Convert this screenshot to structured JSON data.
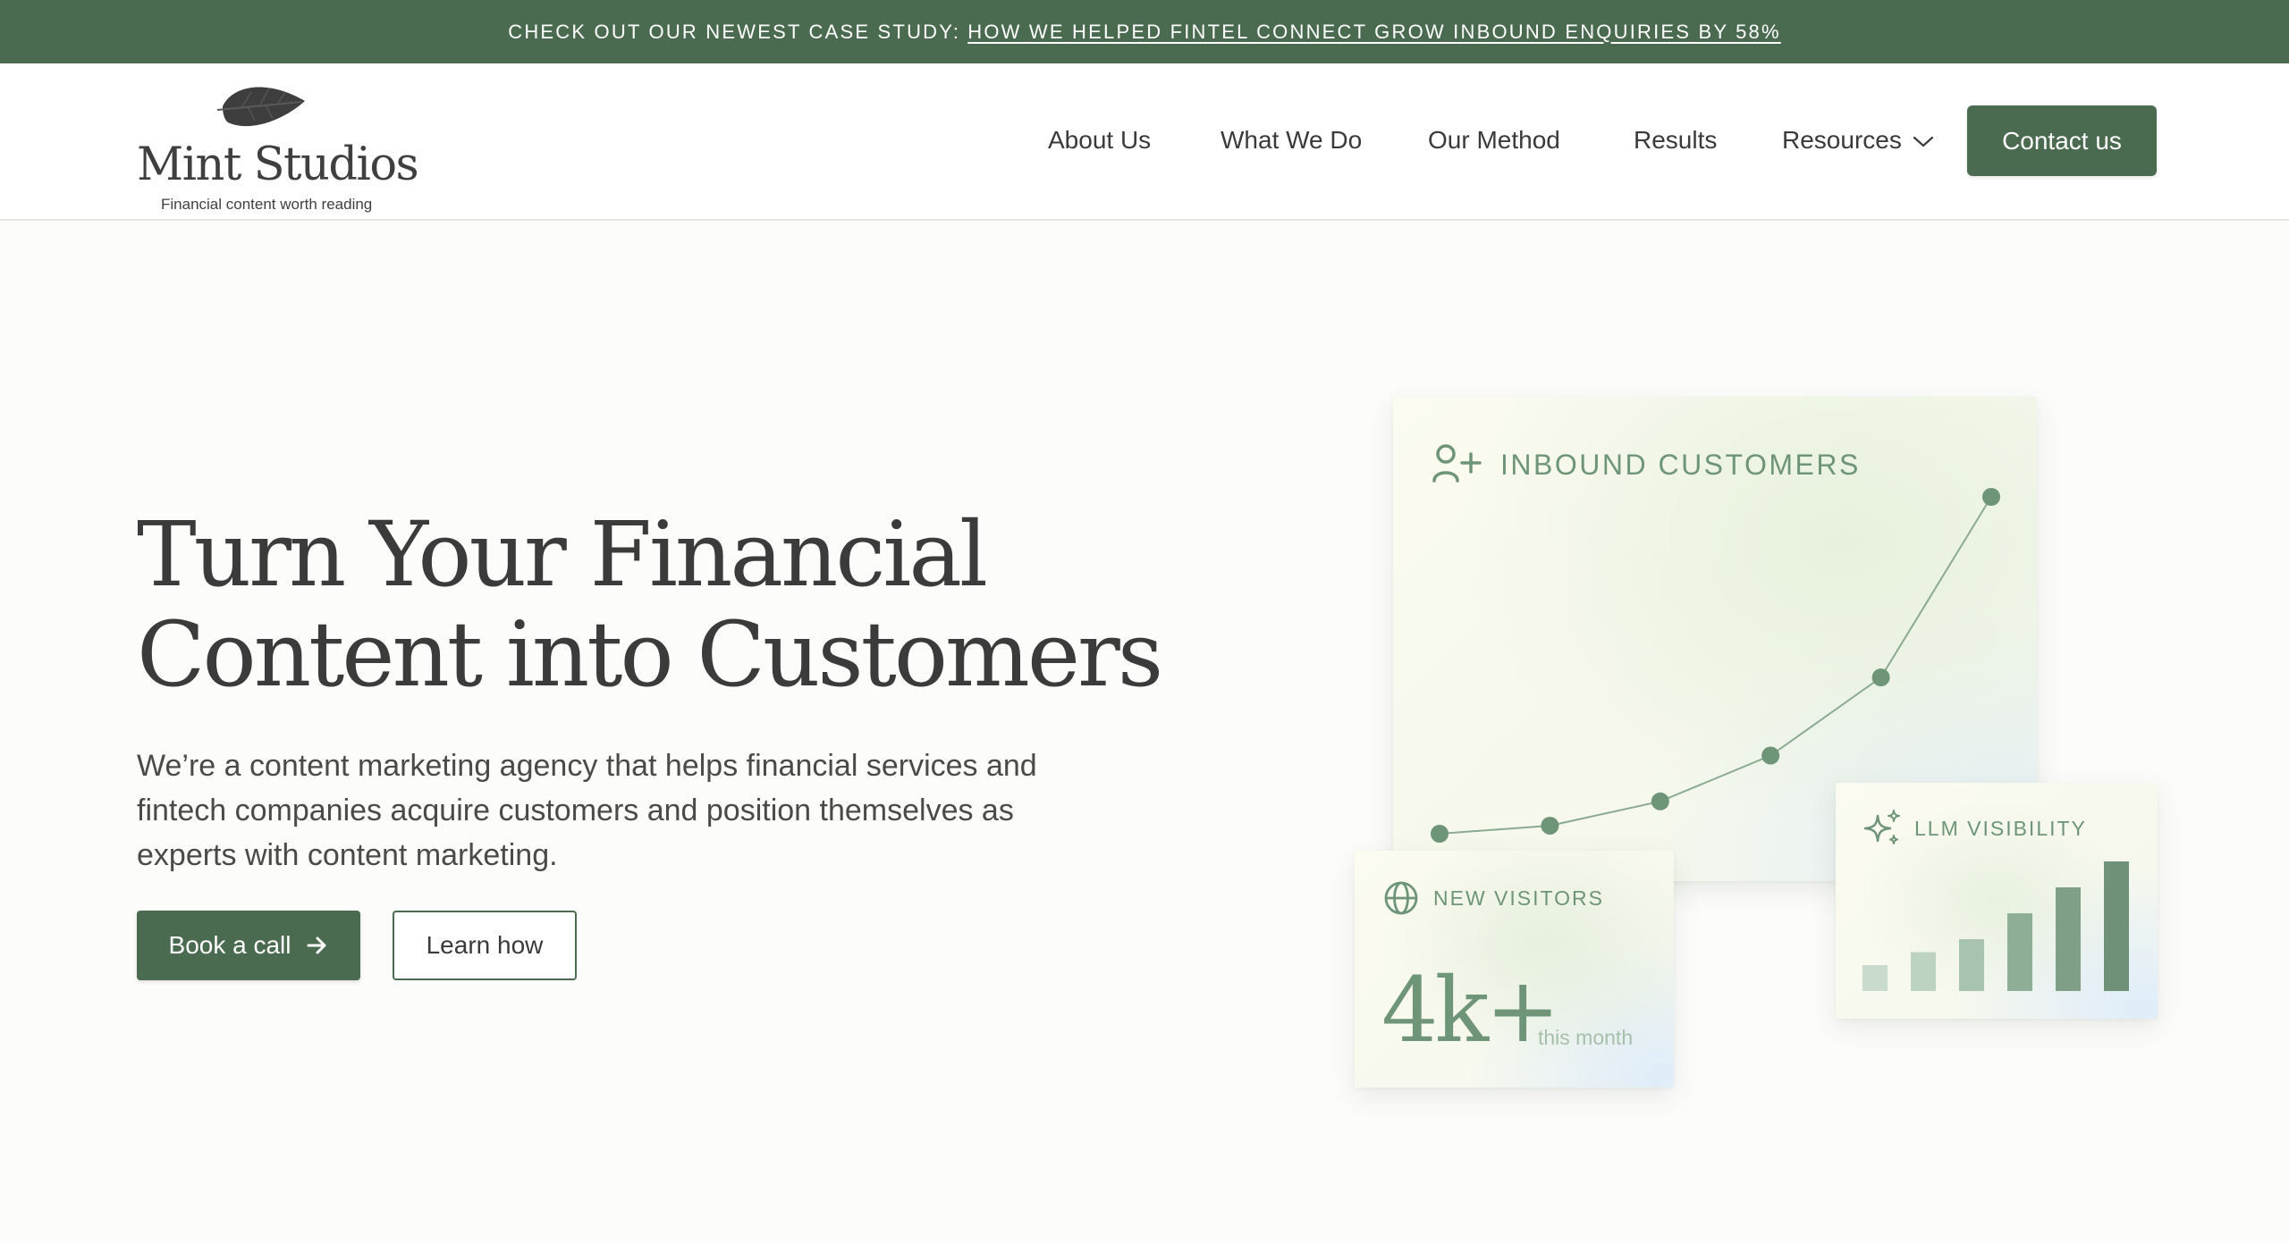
{
  "announcement": {
    "lead": "CHECK OUT OUR NEWEST CASE STUDY:",
    "link": "HOW WE HELPED FINTEL CONNECT GROW INBOUND ENQUIRIES BY 58%"
  },
  "logo": {
    "name": "Mint Studios",
    "tagline": "Financial content worth reading",
    "icon": "leaf-icon"
  },
  "nav": {
    "items": [
      {
        "label": "About Us"
      },
      {
        "label": "What We Do"
      },
      {
        "label": "Our Method"
      },
      {
        "label": "Results"
      },
      {
        "label": "Resources",
        "icon": "chevron-down-icon"
      }
    ],
    "cta": "Contact us"
  },
  "hero": {
    "title_line1": "Turn Your Financial",
    "title_line2": "Content into Customers",
    "subtitle": "We’re a content marketing agency that helps financial services and fintech companies acquire customers and position themselves as experts with content marketing.",
    "primary_button": "Book a call",
    "primary_icon": "arrow-right-icon",
    "secondary_button": "Learn how"
  },
  "cards": {
    "inbound": {
      "label": "INBOUND CUSTOMERS",
      "icon": "user-plus-icon"
    },
    "visitors": {
      "label": "NEW VISITORS",
      "value": "4k+",
      "caption": "this month",
      "icon": "globe-icon"
    },
    "llm": {
      "label": "LLM VISIBILITY",
      "icon": "sparkles-icon"
    }
  },
  "colors": {
    "brand": "#4b6b50",
    "accent": "#6e9577",
    "background": "#fcfcfa"
  },
  "chart_data": [
    {
      "type": "line",
      "title": "INBOUND CUSTOMERS",
      "x": [
        1,
        2,
        3,
        4,
        5,
        6
      ],
      "values": [
        1,
        1.3,
        2.2,
        3.9,
        6.8,
        13.5
      ],
      "ylim": [
        0,
        14
      ],
      "grid": false
    },
    {
      "type": "bar",
      "title": "LLM VISIBILITY",
      "categories": [
        "1",
        "2",
        "3",
        "4",
        "5",
        "6"
      ],
      "values": [
        1,
        1.5,
        2,
        3,
        4,
        5
      ],
      "ylim": [
        0,
        5
      ],
      "bar_colors": [
        "#c9dbcd",
        "#bdd3c2",
        "#a8c4ae",
        "#8eae95",
        "#7f9f86",
        "#6f9177"
      ]
    }
  ]
}
